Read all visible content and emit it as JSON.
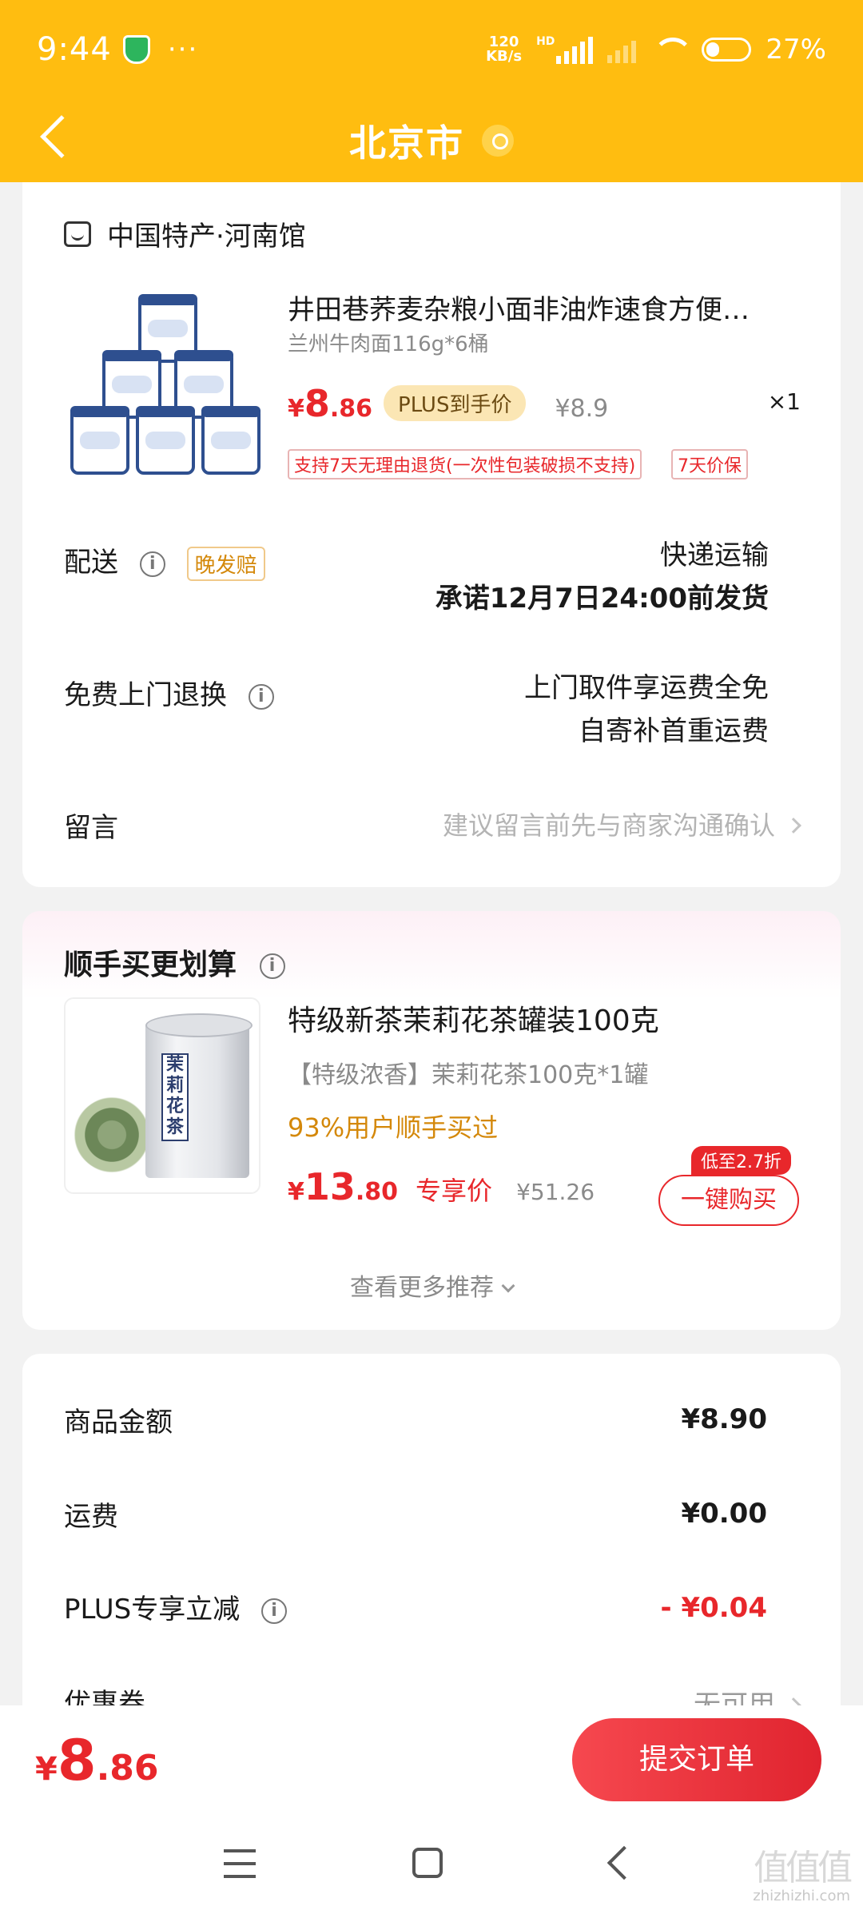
{
  "status_bar": {
    "time": "9:44",
    "dots": "···",
    "net_speed_top": "120",
    "net_speed_bottom": "KB/s",
    "net_type": "HD",
    "battery_pct": "27%"
  },
  "header": {
    "title": "北京市"
  },
  "order_item": {
    "shop_name": "中国特产·河南馆",
    "product_title": "井田巷荞麦杂粮小面非油炸速食方便…",
    "spec": "兰州牛肉面116g*6桶",
    "price_yen": "¥",
    "price_int": "8",
    "price_dec": ".86",
    "plus_badge": "PLUS到手价",
    "orig_price": "¥8.9",
    "quantity": "×1",
    "tags": [
      "支持7天无理由退货(一次性包装破损不支持)",
      "7天价保"
    ]
  },
  "delivery": {
    "label": "配送",
    "info_icon": "i",
    "late_badge": "晚发赔",
    "method": "快递运输",
    "promise": "承诺12月7日24:00前发货"
  },
  "returns": {
    "label": "免费上门退换",
    "info_icon": "i",
    "line1": "上门取件享运费全免",
    "line2": "自寄补首重运费"
  },
  "message": {
    "label": "留言",
    "placeholder": "建议留言前先与商家沟通确认"
  },
  "recommend": {
    "section_title": "顺手买更划算",
    "info_icon": "i",
    "image_label": "茉莉花茶",
    "name": "特级新茶茉莉花茶罐装100克",
    "subtitle": "【特级浓香】茉莉花茶100克*1罐",
    "social_proof": "93%用户顺手买过",
    "price_yen": "¥",
    "price_int": "13",
    "price_dec": ".80",
    "exclusive_label": "专享价",
    "orig_price": "¥51.26",
    "discount_tag": "低至2.7折",
    "buy_button": "一键购买",
    "more_link": "查看更多推荐"
  },
  "summary": {
    "goods_amount_label": "商品金额",
    "goods_amount": "¥8.90",
    "shipping_label": "运费",
    "shipping": "¥0.00",
    "plus_discount_label": "PLUS专享立减",
    "info_icon": "i",
    "plus_discount": "- ¥0.04",
    "coupon_label": "优惠券",
    "coupon_value": "无可用"
  },
  "bottom_bar": {
    "total_yen": "¥",
    "total_int": "8",
    "total_dec": ".86",
    "submit_button": "提交订单"
  },
  "watermark": {
    "glyphs": "值值值",
    "site": "zhizhizhi.com"
  },
  "colors": {
    "brand_yellow": "#ffbd10",
    "price_red": "#e8272b",
    "accent_orange": "#d4880a"
  },
  "icons": [
    "shield-icon",
    "signal-icon",
    "wifi-icon",
    "battery-icon",
    "back-arrow-icon",
    "location-icon",
    "shop-icon",
    "info-icon",
    "chevron-right-icon",
    "chevron-down-icon",
    "menu-icon",
    "home-icon",
    "back-icon"
  ]
}
